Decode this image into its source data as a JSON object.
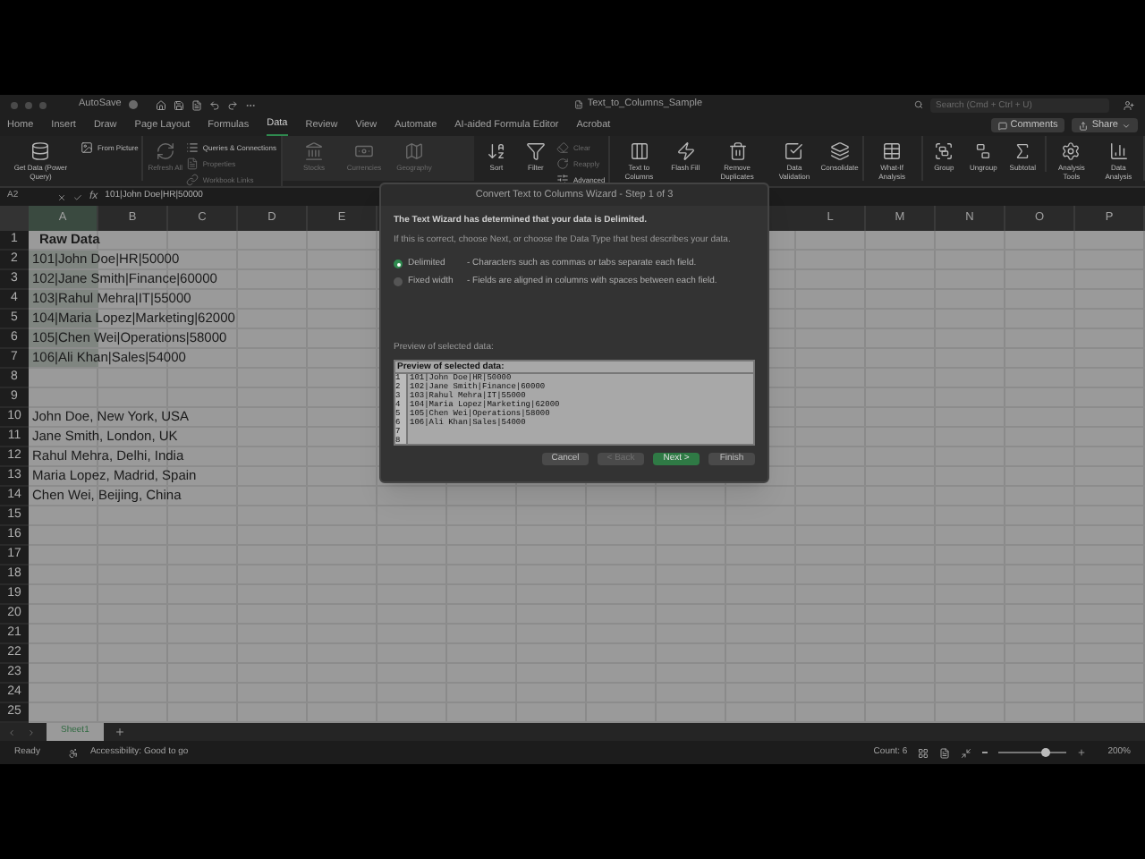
{
  "window": {
    "autosave": "AutoSave",
    "title": "Text_to_Columns_Sample",
    "search": {
      "placeholder": "Search (Cmd + Ctrl + U)"
    }
  },
  "tabs": [
    {
      "label": "Home",
      "selected": false
    },
    {
      "label": "Insert",
      "selected": false
    },
    {
      "label": "Draw",
      "selected": false
    },
    {
      "label": "Page Layout",
      "selected": false
    },
    {
      "label": "Formulas",
      "selected": false
    },
    {
      "label": "Data",
      "selected": true
    },
    {
      "label": "Review",
      "selected": false
    },
    {
      "label": "View",
      "selected": false
    },
    {
      "label": "Automate",
      "selected": false
    },
    {
      "label": "AI-aided Formula Editor",
      "selected": false
    },
    {
      "label": "Acrobat",
      "selected": false
    }
  ],
  "header_buttons": [
    "Comments",
    "Share"
  ],
  "ribbon": [
    {
      "kind": "plain",
      "items": [
        {
          "kind": "large",
          "label": "Get Data (Power Query)",
          "disabled": false
        },
        {
          "kind": "small",
          "label": "From Picture",
          "disabled": false
        }
      ]
    },
    {
      "kind": "plain",
      "items": [
        {
          "kind": "large",
          "label": "Refresh All",
          "disabled": true
        },
        {
          "kind": "small",
          "label": "Queries & Connections",
          "disabled": false
        },
        {
          "kind": "small",
          "label": "Properties",
          "disabled": true
        },
        {
          "kind": "small",
          "label": "Workbook Links",
          "disabled": true
        }
      ]
    },
    {
      "kind": "boxed",
      "items": [
        {
          "kind": "large",
          "label": "Stocks",
          "disabled": true
        },
        {
          "kind": "large",
          "label": "Currencies",
          "disabled": true
        },
        {
          "kind": "large",
          "label": "Geography",
          "disabled": true
        }
      ]
    },
    {
      "kind": "plain",
      "items": [
        {
          "kind": "large",
          "label": "Sort",
          "disabled": false
        },
        {
          "kind": "large",
          "label": "Filter",
          "disabled": false
        },
        {
          "kind": "small",
          "label": "Clear",
          "disabled": true
        },
        {
          "kind": "small",
          "label": "Reapply",
          "disabled": true
        },
        {
          "kind": "small",
          "label": "Advanced",
          "disabled": false
        }
      ]
    },
    {
      "kind": "plain",
      "items": [
        {
          "kind": "large",
          "label": "Text to Columns",
          "disabled": false
        },
        {
          "kind": "large",
          "label": "Flash Fill",
          "disabled": false
        },
        {
          "kind": "large",
          "label": "Remove Duplicates",
          "disabled": false
        },
        {
          "kind": "large",
          "label": "Data Validation",
          "disabled": false
        },
        {
          "kind": "large",
          "label": "Consolidate",
          "disabled": false
        }
      ]
    },
    {
      "kind": "plain",
      "items": [
        {
          "kind": "large",
          "label": "What-If Analysis",
          "disabled": false
        }
      ]
    },
    {
      "kind": "plain",
      "items": [
        {
          "kind": "large",
          "label": "Group",
          "disabled": false
        },
        {
          "kind": "large",
          "label": "Ungroup",
          "disabled": false
        },
        {
          "kind": "large",
          "label": "Subtotal",
          "disabled": false
        }
      ]
    },
    {
      "kind": "plain",
      "items": [
        {
          "kind": "large",
          "label": "Analysis Tools",
          "disabled": false
        },
        {
          "kind": "large",
          "label": "Data Analysis",
          "disabled": false
        }
      ]
    }
  ],
  "formula_bar": {
    "cell": "A2",
    "function_symbol": "fx",
    "formula": "101|John Doe|HR|50000"
  },
  "columns_left": [
    "A",
    "B",
    "C",
    "D",
    "E"
  ],
  "columns_right": [
    "L",
    "M",
    "N",
    "O",
    "P"
  ],
  "rows": [
    {
      "number": "1",
      "text": "Raw Data",
      "kind": "header",
      "selected": false
    },
    {
      "number": "2",
      "text": "101|John Doe|HR|50000",
      "kind": "data",
      "selected": true
    },
    {
      "number": "3",
      "text": "102|Jane Smith|Finance|60000",
      "kind": "data",
      "selected": true
    },
    {
      "number": "4",
      "text": "103|Rahul Mehra|IT|55000",
      "kind": "data",
      "selected": true
    },
    {
      "number": "5",
      "text": "104|Maria Lopez|Marketing|62000",
      "kind": "data",
      "selected": true
    },
    {
      "number": "6",
      "text": "105|Chen Wei|Operations|58000",
      "kind": "data",
      "selected": true
    },
    {
      "number": "7",
      "text": "106|Ali Khan|Sales|54000",
      "kind": "data",
      "selected": true
    },
    {
      "number": "8",
      "selected": false
    },
    {
      "number": "9",
      "selected": false
    },
    {
      "number": "10",
      "text": "John Doe, New York, USA",
      "kind": "data",
      "selected": false
    },
    {
      "number": "11",
      "text": "Jane Smith, London, UK",
      "kind": "data",
      "selected": false
    },
    {
      "number": "12",
      "text": "Rahul Mehra, Delhi, India",
      "kind": "data",
      "selected": false
    },
    {
      "number": "13",
      "text": "Maria Lopez, Madrid, Spain",
      "kind": "data",
      "selected": false
    },
    {
      "number": "14",
      "text": "Chen Wei, Beijing, China",
      "kind": "data",
      "selected": false
    },
    {
      "number": "15",
      "selected": false
    },
    {
      "number": "16",
      "selected": false
    },
    {
      "number": "17",
      "selected": false
    },
    {
      "number": "18",
      "selected": false
    },
    {
      "number": "19",
      "selected": false
    },
    {
      "number": "20",
      "selected": false
    },
    {
      "number": "21",
      "selected": false
    },
    {
      "number": "22",
      "selected": false
    },
    {
      "number": "23",
      "selected": false
    },
    {
      "number": "24",
      "selected": false
    },
    {
      "number": "25",
      "selected": false
    }
  ],
  "sheet_tabs": [
    {
      "label": "Sheet1",
      "selected": true
    }
  ],
  "status_bar": {
    "ready": "Ready",
    "accessibility": "Accessibility: Good to go",
    "count": "Count: 6",
    "zoom": {
      "level": 0.7
    },
    "zoom_reading": "200%"
  },
  "dialog": {
    "title": "Convert Text to Columns Wizard - Step 1 of 3",
    "heading": "The Text Wizard has determined that your data is Delimited.",
    "instruction": "If this is correct, choose Next, or choose the Data Type that best describes your data.",
    "options": [
      {
        "label": "Delimited",
        "description": "- Characters such as commas or tabs separate each field.",
        "selected": true
      },
      {
        "label": "Fixed width",
        "description": "- Fields are aligned in columns with spaces between each field.",
        "selected": false
      }
    ],
    "preview_label": "Preview of selected data:",
    "preview_header": "Preview of selected data:",
    "preview_lines": [
      {
        "number": "1",
        "text": "101|John Doe|HR|50000"
      },
      {
        "number": "2",
        "text": "102|Jane Smith|Finance|60000"
      },
      {
        "number": "3",
        "text": "103|Rahul Mehra|IT|55000"
      },
      {
        "number": "4",
        "text": "104|Maria Lopez|Marketing|62000"
      },
      {
        "number": "5",
        "text": "105|Chen Wei|Operations|58000"
      },
      {
        "number": "6",
        "text": "106|Ali Khan|Sales|54000"
      },
      {
        "number": "7"
      },
      {
        "number": "8"
      }
    ],
    "buttons": [
      {
        "label": "Cancel",
        "kind": "normal",
        "disabled": false
      },
      {
        "label": "< Back",
        "kind": "normal",
        "disabled": true
      },
      {
        "label": "Next >",
        "kind": "primary",
        "disabled": false
      },
      {
        "label": "Finish",
        "kind": "normal",
        "disabled": false
      }
    ]
  }
}
